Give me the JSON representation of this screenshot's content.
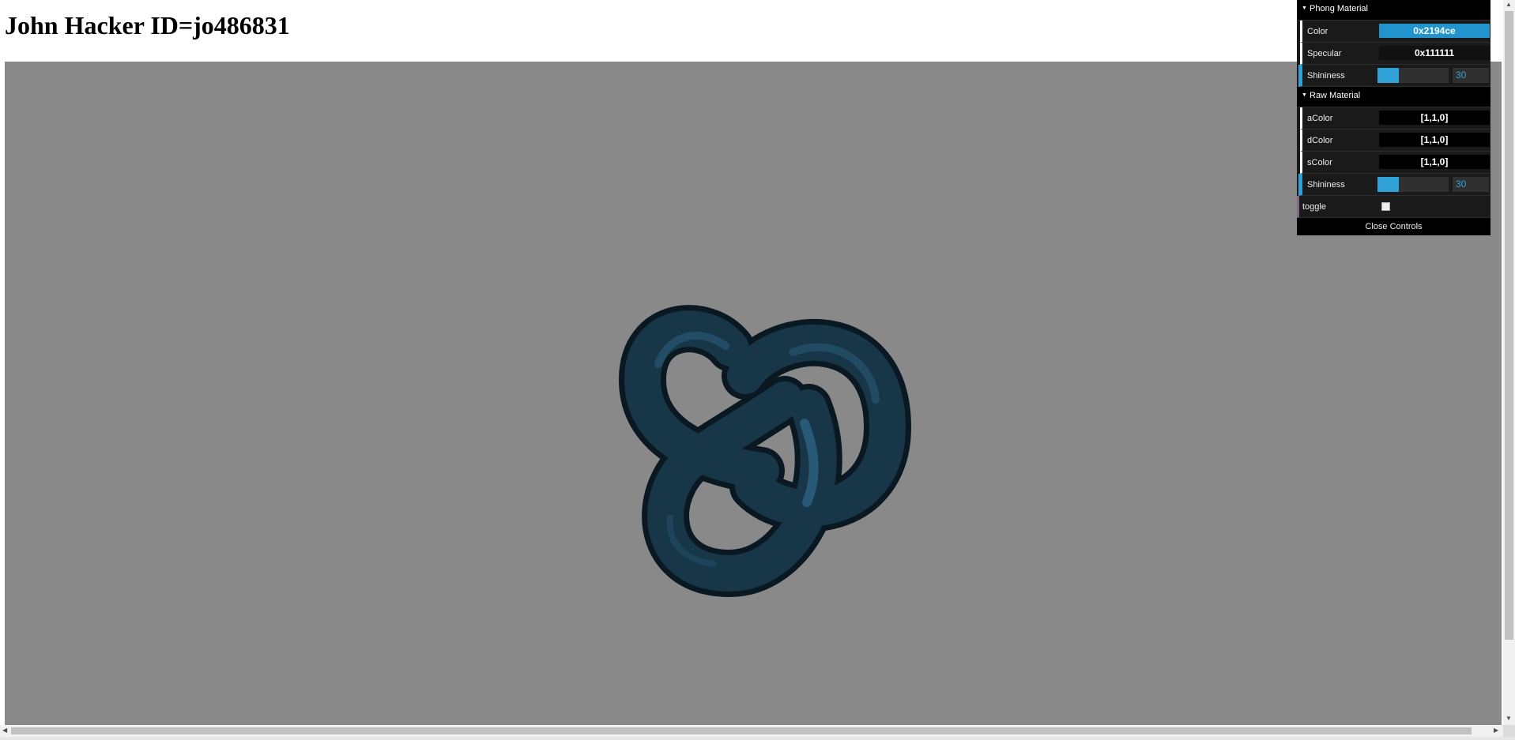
{
  "page": {
    "title": "John Hacker ID=jo486831"
  },
  "scene": {
    "background_color": "#898989",
    "knot_color": "#1c3f55"
  },
  "gui": {
    "phong_folder": {
      "title": "Phong Material",
      "color": {
        "label": "Color",
        "value": "0x2194ce",
        "swatch": "#2194ce"
      },
      "specular": {
        "label": "Specular",
        "value": "0x111111",
        "swatch": "#111111"
      },
      "shininess": {
        "label": "Shininess",
        "value": "30",
        "fraction": 0.3
      }
    },
    "raw_folder": {
      "title": "Raw Material",
      "acolor": {
        "label": "aColor",
        "value": "[1,1,0]"
      },
      "dcolor": {
        "label": "dColor",
        "value": "[1,1,0]"
      },
      "scolor": {
        "label": "sColor",
        "value": "[1,1,0]"
      },
      "shininess": {
        "label": "Shininess",
        "value": "30",
        "fraction": 0.3
      }
    },
    "toggle": {
      "label": "toggle",
      "checked": false
    },
    "close_label": "Close Controls"
  }
}
